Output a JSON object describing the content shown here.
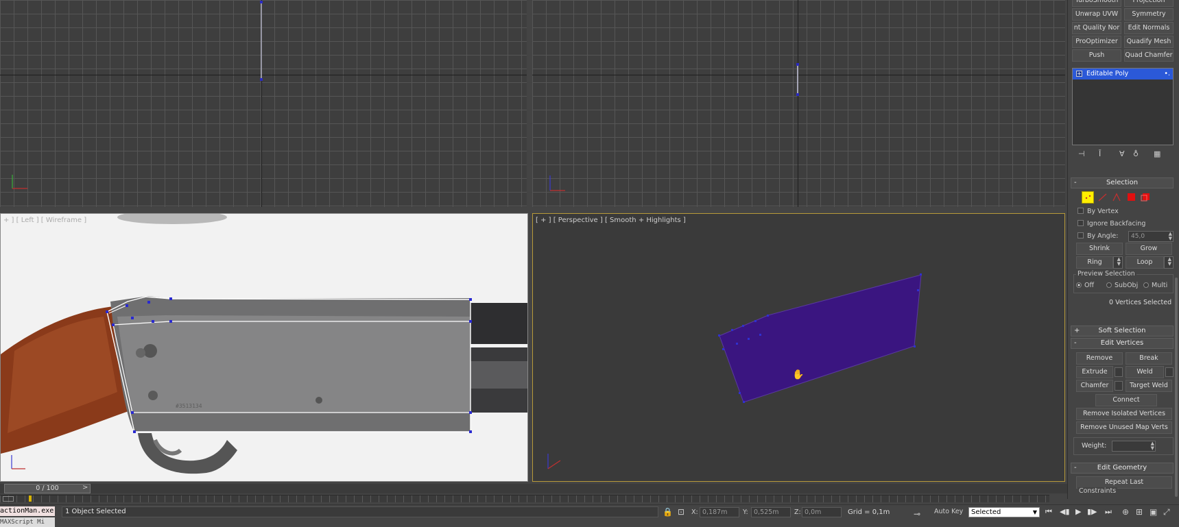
{
  "modifier_buttons": [
    {
      "label": "TurboSmooth"
    },
    {
      "label": "Projection"
    },
    {
      "label": "Unwrap UVW"
    },
    {
      "label": "Symmetry"
    },
    {
      "label": "nt Quality Nor"
    },
    {
      "label": "Edit Normals"
    },
    {
      "label": "ProOptimizer"
    },
    {
      "label": "Quadify Mesh"
    },
    {
      "label": "Push"
    },
    {
      "label": "Quad Chamfer"
    }
  ],
  "modifier_stack": {
    "items": [
      {
        "label": "Editable Poly"
      }
    ]
  },
  "viewports": {
    "left_label": "+ ] [ Left ] [ Wireframe ]",
    "persp_label": "[ + ] [ Perspective ] [ Smooth + Highlights ]"
  },
  "selection": {
    "title": "Selection",
    "by_vertex": "By Vertex",
    "ignore_backfacing": "Ignore Backfacing",
    "by_angle": "By Angle:",
    "by_angle_value": "45,0",
    "shrink": "Shrink",
    "grow": "Grow",
    "ring": "Ring",
    "loop": "Loop",
    "preview_title": "Preview Selection",
    "off": "Off",
    "subobj": "SubObj",
    "multi": "Multi",
    "count": "0 Vertices Selected"
  },
  "soft_selection": {
    "title": "Soft Selection"
  },
  "edit_vertices": {
    "title": "Edit Vertices",
    "remove": "Remove",
    "break": "Break",
    "extrude": "Extrude",
    "weld": "Weld",
    "chamfer": "Chamfer",
    "target_weld": "Target Weld",
    "connect": "Connect",
    "remove_isolated": "Remove Isolated Vertices",
    "remove_unused": "Remove Unused Map Verts",
    "weight": "Weight:"
  },
  "edit_geometry": {
    "title": "Edit Geometry",
    "repeat_last": "Repeat Last",
    "constraints": "Constraints"
  },
  "timeline": {
    "frame": "0 / 100",
    "next": ">"
  },
  "status": {
    "maxscript": "actionMan.exe",
    "maxscript2": "MAXScript Mi",
    "message": "1 Object Selected",
    "x_label": "X:",
    "x_value": "0,187m",
    "y_label": "Y:",
    "y_value": "0,525m",
    "z_label": "Z:",
    "z_value": "0,0m",
    "grid": "Grid = 0,1m",
    "auto_key": "Auto Key",
    "selected": "Selected"
  },
  "colors": {
    "polygon": "#3a1580",
    "stack_highlight": "#2b59d8",
    "vertex_active": "#ffee00",
    "element_red": "#e01010"
  }
}
